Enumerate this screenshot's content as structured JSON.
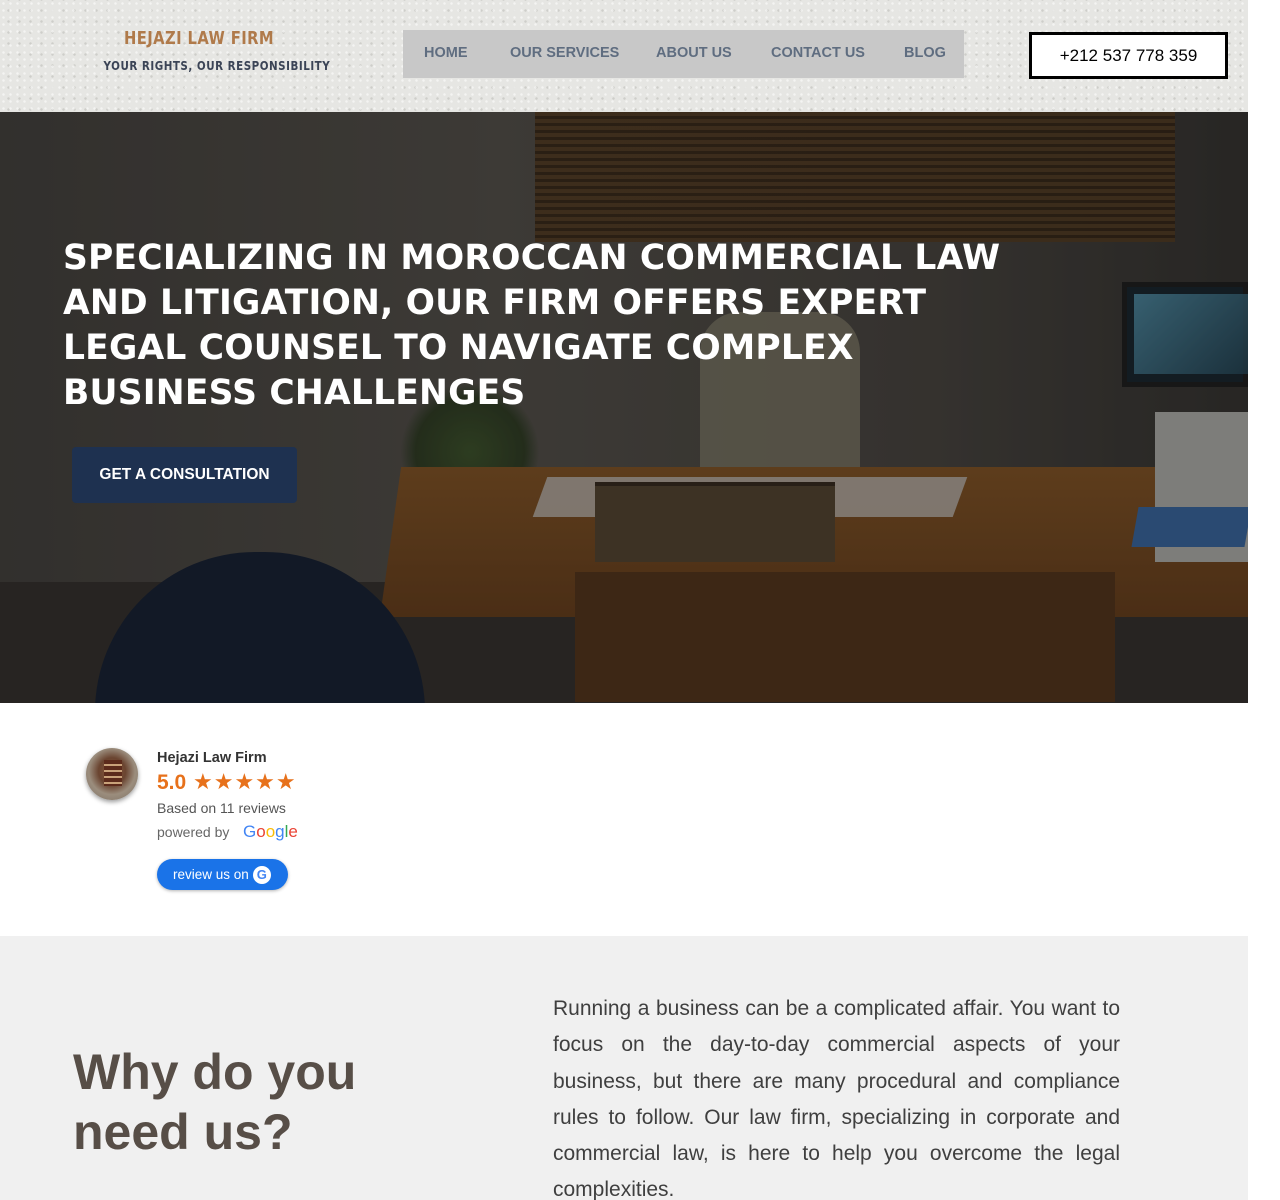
{
  "header": {
    "logo_title": "HEJAZI LAW FIRM",
    "logo_tagline": "YOUR RIGHTS, OUR RESPONSIBILITY",
    "nav": [
      {
        "label": "HOME"
      },
      {
        "label": "OUR SERVICES"
      },
      {
        "label": "ABOUT US"
      },
      {
        "label": "CONTACT US"
      },
      {
        "label": "BLOG"
      }
    ],
    "phone": "+212 537 778 359"
  },
  "hero": {
    "headline": "SPECIALIZING IN MOROCCAN COMMERCIAL LAW AND LITIGATION, OUR FIRM OFFERS EXPERT LEGAL COUNSEL TO NAVIGATE COMPLEX BUSINESS CHALLENGES",
    "cta_label": "GET A CONSULTATION"
  },
  "reviews": {
    "name": "Hejazi Law Firm",
    "score": "5.0",
    "stars": "★★★★★",
    "rating_value": 5,
    "based_on": "Based on 11 reviews",
    "powered_by": "powered by",
    "google": [
      "G",
      "o",
      "o",
      "g",
      "l",
      "e"
    ],
    "google_colors": [
      "#4285f4",
      "#ea4335",
      "#fbbc05",
      "#4285f4",
      "#34a853",
      "#ea4335"
    ],
    "review_button": "review us on",
    "review_button_icon": "G",
    "star_color": "#e7711b"
  },
  "why": {
    "title": "Why do you need us?",
    "text": "Running a business can be a complicated affair. You want to focus on the day-to-day commercial aspects of your business, but there are many procedural and compliance rules to follow. Our law firm, specializing in corporate and commercial law, is here to help you overcome the legal complexities."
  },
  "colors": {
    "logo_title": "#b07a4a",
    "nav_background": "#c8c8c8",
    "nav_text": "#5f6d80",
    "cta_background": "#1e3150",
    "review_button": "#1a73e8",
    "why_background": "#f0f0f0",
    "why_title": "#574e47"
  }
}
